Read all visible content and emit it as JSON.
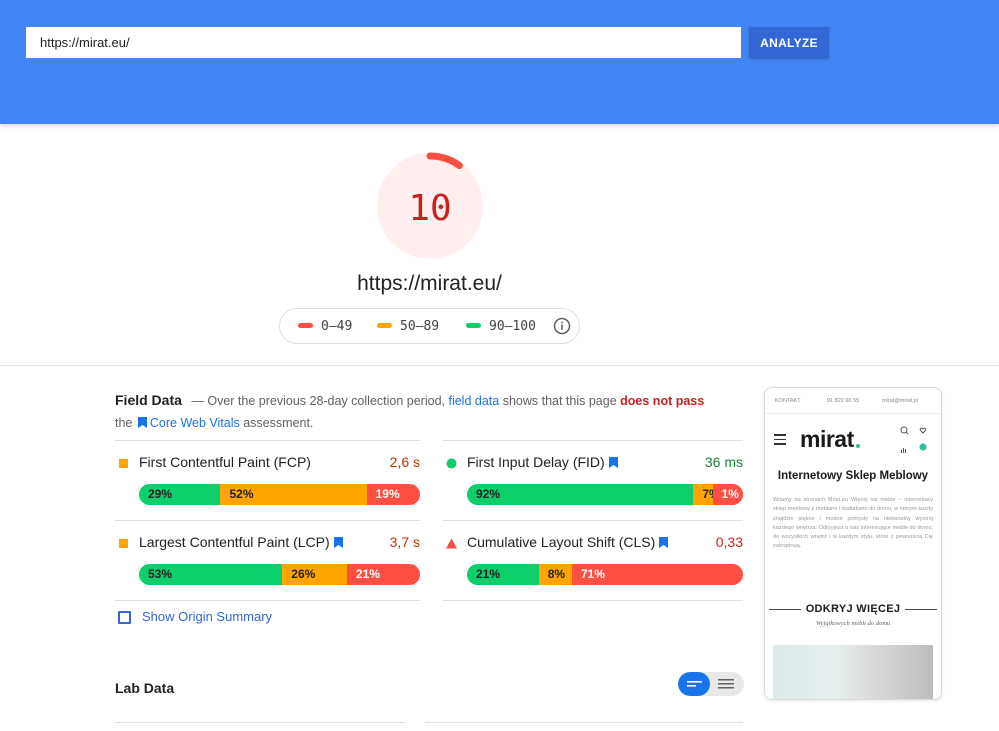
{
  "search": {
    "value": "https://mirat.eu/",
    "button_label": "ANALYZE"
  },
  "score": {
    "value": "10",
    "progress_fraction": 0.1,
    "url": "https://mirat.eu/",
    "legend": [
      {
        "label": "0–49",
        "color": "#ff4e42"
      },
      {
        "label": "50–89",
        "color": "#ffa400"
      },
      {
        "label": "90–100",
        "color": "#0cce6b"
      }
    ]
  },
  "field_data": {
    "title": "Field Data",
    "desc_1": "— Over the previous 28-day collection period,",
    "desc_link": "field data",
    "desc_2": "shows that this page",
    "desc_fail": "does not pass",
    "desc_3": "the",
    "desc_cwv": "Core Web Vitals",
    "desc_4": "assessment.",
    "metrics": [
      {
        "name": "First Contentful Paint (FCP)",
        "value": "2,6 s",
        "value_color": "#c33300",
        "icon": "square",
        "icon_color": "#ffa400",
        "core": false,
        "dist": [
          {
            "label": "29%",
            "pct": 29,
            "cls": "good"
          },
          {
            "label": "52%",
            "pct": 52,
            "cls": "avg"
          },
          {
            "label": "19%",
            "pct": 19,
            "cls": "poor"
          }
        ]
      },
      {
        "name": "First Input Delay (FID)",
        "value": "36 ms",
        "value_color": "#178239",
        "icon": "circle",
        "icon_color": "#0cce6b",
        "core": true,
        "dist": [
          {
            "label": "92%",
            "pct": 82,
            "cls": "good"
          },
          {
            "label": "7%",
            "pct": 7,
            "cls": "avg"
          },
          {
            "label": "1%",
            "pct": 11,
            "cls": "poor"
          }
        ]
      },
      {
        "name": "Largest Contentful Paint (LCP)",
        "value": "3,7 s",
        "value_color": "#c33300",
        "icon": "square",
        "icon_color": "#ffa400",
        "core": true,
        "dist": [
          {
            "label": "53%",
            "pct": 51,
            "cls": "good"
          },
          {
            "label": "26%",
            "pct": 23,
            "cls": "avg"
          },
          {
            "label": "21%",
            "pct": 26,
            "cls": "poor"
          }
        ]
      },
      {
        "name": "Cumulative Layout Shift (CLS)",
        "value": "0,33",
        "value_color": "#c5221f",
        "icon": "triangle",
        "icon_color": "#ff4e42",
        "core": true,
        "dist": [
          {
            "label": "21%",
            "pct": 26,
            "cls": "good"
          },
          {
            "label": "8%",
            "pct": 12,
            "cls": "avg"
          },
          {
            "label": "71%",
            "pct": 62,
            "cls": "poor"
          }
        ]
      }
    ],
    "origin_label": "Show Origin Summary"
  },
  "lab_data": {
    "title": "Lab Data"
  },
  "phone": {
    "top_contact": "KONTAKT",
    "top_phone": "91 822 60 55",
    "top_email": "mirat@mirat.pl",
    "logo": "mirat",
    "heading": "Internetowy Sklep Meblowy",
    "body": "Witamy na stronach Mirat.eu Więcej niż meble – internetowy sklep meblowy z meblami i dodatkami do domu, w którym każdy znajdzie piękne i modne pomysły na niebanalny wystrój każdego wnętrza. Odkryjesz u nas interesujące meble do domu, do wszystkich wnętrz i w każdym stylu, które z pewnością Cię zainspirują.",
    "section_title": "ODKRYJ WIĘCEJ",
    "section_sub": "Wyjątkowych mebli do domu"
  }
}
